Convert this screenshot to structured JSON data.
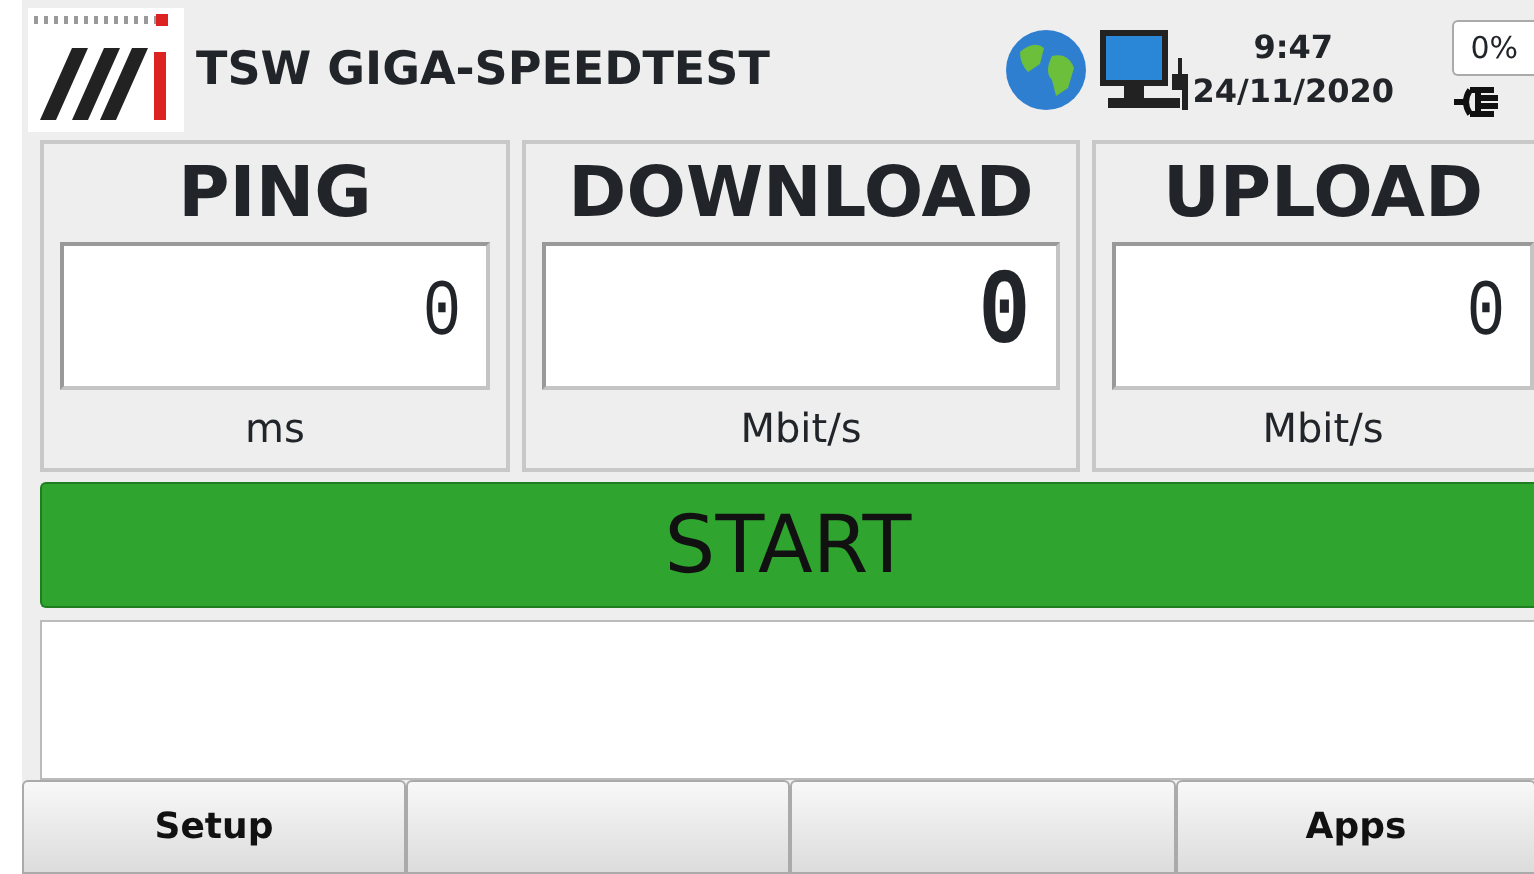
{
  "header": {
    "title": "TSW GIGA-SPEEDTEST",
    "time": "9:47",
    "date": "24/11/2020",
    "battery": "0%"
  },
  "panels": [
    {
      "title": "PING",
      "value": "0",
      "unit": "ms",
      "emphasized": false
    },
    {
      "title": "DOWNLOAD",
      "value": "0",
      "unit": "Mbit/s",
      "emphasized": true
    },
    {
      "title": "UPLOAD",
      "value": "0",
      "unit": "Mbit/s",
      "emphasized": false
    }
  ],
  "start_button": {
    "label": "START"
  },
  "footer_buttons": [
    {
      "kind": "labeled",
      "label": "Setup"
    },
    {
      "kind": "blank"
    },
    {
      "kind": "blank"
    },
    {
      "kind": "labeled",
      "label": "Apps"
    }
  ]
}
